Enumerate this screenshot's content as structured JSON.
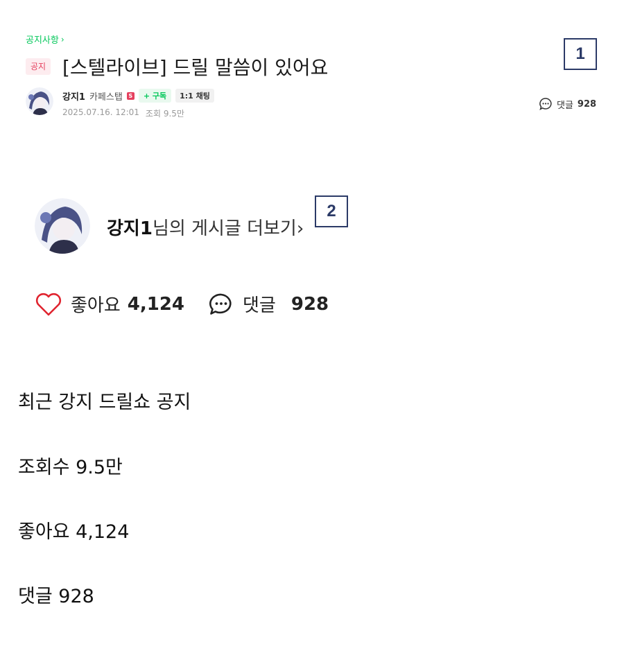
{
  "header": {
    "board_link": "공지사항",
    "notice_badge": "공지",
    "title": "[스텔라이브] 드릴 말씀이 있어요"
  },
  "author": {
    "name": "강지1",
    "grade": "카페스탭",
    "grade_icon_text": "S",
    "subscribe_label": "+ 구독",
    "chat_label": "1:1 채팅",
    "date": "2025.07.16. 12:01",
    "views": "조회 9.5만"
  },
  "comments_top": {
    "label": "댓글",
    "count": "928"
  },
  "markers": [
    "1",
    "2"
  ],
  "more_posts": {
    "name": "강지1",
    "suffix": "님의 게시글 더보기",
    "chevron": "›"
  },
  "reactions": {
    "like_label": "좋아요",
    "like_count": "4,124",
    "comment_label": "댓글",
    "comment_count": "928"
  },
  "body_lines": [
    "최근 강지 드릴쇼 공지",
    "조회수 9.5만",
    "좋아요 4,124",
    "댓글 928"
  ],
  "colors": {
    "brand_green": "#03c75a",
    "notice_red": "#e5405e",
    "marker_navy": "#2b3a67"
  },
  "icons": [
    "chevron-right-icon",
    "comment-bubble-icon",
    "heart-icon",
    "avatar"
  ]
}
